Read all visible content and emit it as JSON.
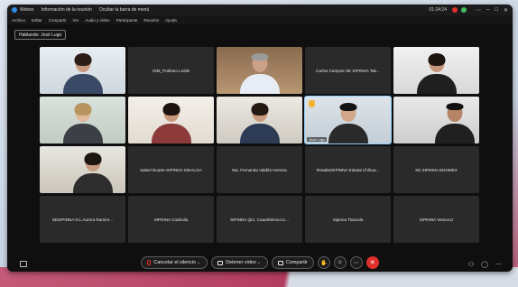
{
  "window": {
    "app_name": "Webex",
    "meeting_info": "Información de la reunión",
    "hide_menu": "Ocultar la barra de menú",
    "time": "01:24:24"
  },
  "menu": [
    "Archivo",
    "Editar",
    "Compartir",
    "Ver",
    "Audio y vídeo",
    "Participante",
    "Reunión",
    "Ayuda"
  ],
  "speaking": "Hablando: José Lugo",
  "tiles": [
    {
      "name": "",
      "video": true
    },
    {
      "name": "OIM_Poblano Leslie",
      "video": false
    },
    {
      "name": "",
      "video": true
    },
    {
      "name": "Carlos Campos SE SIPINNA Tab...",
      "video": false
    },
    {
      "name": "",
      "video": true
    },
    {
      "name": "",
      "video": true
    },
    {
      "name": "",
      "video": true
    },
    {
      "name": "",
      "video": true
    },
    {
      "name": "José Lugo",
      "video": true,
      "active": true
    },
    {
      "name": "",
      "video": true
    },
    {
      "name": "",
      "video": true
    },
    {
      "name": "Isabel Duarte-SIPINNA SINALOA",
      "video": false
    },
    {
      "name": "Ma. Fernanda Valdés Herrera",
      "video": false
    },
    {
      "name": "Rosalia/SIPINNA Estatal Chihua...",
      "video": false
    },
    {
      "name": "SE SIPINNA EDOMEX",
      "video": false
    },
    {
      "name": "SESIPINNA N.L Aurora Ramire...",
      "video": false
    },
    {
      "name": "SIPINNA Coahuila",
      "video": false
    },
    {
      "name": "SIPINNA Qro. CuauhtémocAc...",
      "video": false
    },
    {
      "name": "Sipinna Tlaxcala",
      "video": false
    },
    {
      "name": "SIPINNA Veracruz",
      "video": false
    }
  ],
  "toolbar": {
    "unmute": "Cancelar el silencio",
    "stop_video": "Detener video",
    "share": "Compartir"
  },
  "colors": {
    "end_call": "#e0302c",
    "accent": "#b23c60"
  }
}
